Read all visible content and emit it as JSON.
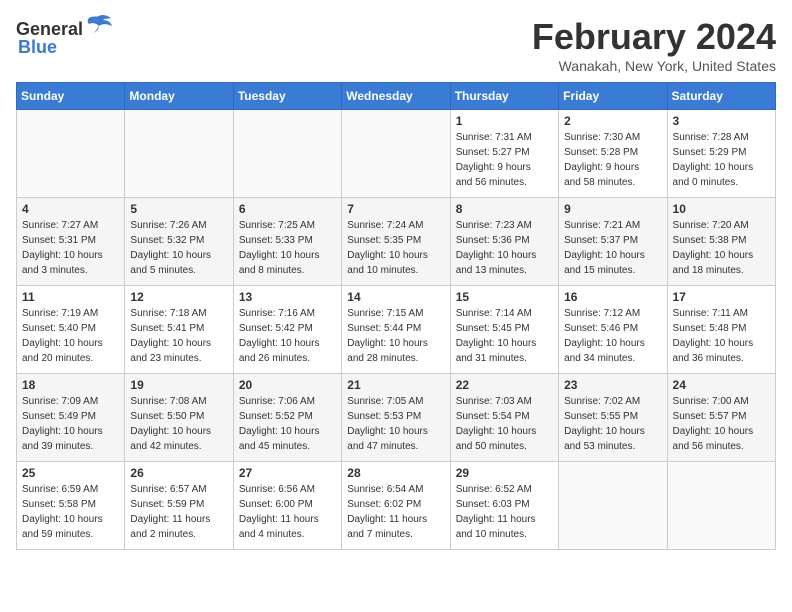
{
  "header": {
    "logo_general": "General",
    "logo_blue": "Blue",
    "month_year": "February 2024",
    "location": "Wanakah, New York, United States"
  },
  "days_of_week": [
    "Sunday",
    "Monday",
    "Tuesday",
    "Wednesday",
    "Thursday",
    "Friday",
    "Saturday"
  ],
  "weeks": [
    [
      {
        "day": "",
        "info": ""
      },
      {
        "day": "",
        "info": ""
      },
      {
        "day": "",
        "info": ""
      },
      {
        "day": "",
        "info": ""
      },
      {
        "day": "1",
        "info": "Sunrise: 7:31 AM\nSunset: 5:27 PM\nDaylight: 9 hours\nand 56 minutes."
      },
      {
        "day": "2",
        "info": "Sunrise: 7:30 AM\nSunset: 5:28 PM\nDaylight: 9 hours\nand 58 minutes."
      },
      {
        "day": "3",
        "info": "Sunrise: 7:28 AM\nSunset: 5:29 PM\nDaylight: 10 hours\nand 0 minutes."
      }
    ],
    [
      {
        "day": "4",
        "info": "Sunrise: 7:27 AM\nSunset: 5:31 PM\nDaylight: 10 hours\nand 3 minutes."
      },
      {
        "day": "5",
        "info": "Sunrise: 7:26 AM\nSunset: 5:32 PM\nDaylight: 10 hours\nand 5 minutes."
      },
      {
        "day": "6",
        "info": "Sunrise: 7:25 AM\nSunset: 5:33 PM\nDaylight: 10 hours\nand 8 minutes."
      },
      {
        "day": "7",
        "info": "Sunrise: 7:24 AM\nSunset: 5:35 PM\nDaylight: 10 hours\nand 10 minutes."
      },
      {
        "day": "8",
        "info": "Sunrise: 7:23 AM\nSunset: 5:36 PM\nDaylight: 10 hours\nand 13 minutes."
      },
      {
        "day": "9",
        "info": "Sunrise: 7:21 AM\nSunset: 5:37 PM\nDaylight: 10 hours\nand 15 minutes."
      },
      {
        "day": "10",
        "info": "Sunrise: 7:20 AM\nSunset: 5:38 PM\nDaylight: 10 hours\nand 18 minutes."
      }
    ],
    [
      {
        "day": "11",
        "info": "Sunrise: 7:19 AM\nSunset: 5:40 PM\nDaylight: 10 hours\nand 20 minutes."
      },
      {
        "day": "12",
        "info": "Sunrise: 7:18 AM\nSunset: 5:41 PM\nDaylight: 10 hours\nand 23 minutes."
      },
      {
        "day": "13",
        "info": "Sunrise: 7:16 AM\nSunset: 5:42 PM\nDaylight: 10 hours\nand 26 minutes."
      },
      {
        "day": "14",
        "info": "Sunrise: 7:15 AM\nSunset: 5:44 PM\nDaylight: 10 hours\nand 28 minutes."
      },
      {
        "day": "15",
        "info": "Sunrise: 7:14 AM\nSunset: 5:45 PM\nDaylight: 10 hours\nand 31 minutes."
      },
      {
        "day": "16",
        "info": "Sunrise: 7:12 AM\nSunset: 5:46 PM\nDaylight: 10 hours\nand 34 minutes."
      },
      {
        "day": "17",
        "info": "Sunrise: 7:11 AM\nSunset: 5:48 PM\nDaylight: 10 hours\nand 36 minutes."
      }
    ],
    [
      {
        "day": "18",
        "info": "Sunrise: 7:09 AM\nSunset: 5:49 PM\nDaylight: 10 hours\nand 39 minutes."
      },
      {
        "day": "19",
        "info": "Sunrise: 7:08 AM\nSunset: 5:50 PM\nDaylight: 10 hours\nand 42 minutes."
      },
      {
        "day": "20",
        "info": "Sunrise: 7:06 AM\nSunset: 5:52 PM\nDaylight: 10 hours\nand 45 minutes."
      },
      {
        "day": "21",
        "info": "Sunrise: 7:05 AM\nSunset: 5:53 PM\nDaylight: 10 hours\nand 47 minutes."
      },
      {
        "day": "22",
        "info": "Sunrise: 7:03 AM\nSunset: 5:54 PM\nDaylight: 10 hours\nand 50 minutes."
      },
      {
        "day": "23",
        "info": "Sunrise: 7:02 AM\nSunset: 5:55 PM\nDaylight: 10 hours\nand 53 minutes."
      },
      {
        "day": "24",
        "info": "Sunrise: 7:00 AM\nSunset: 5:57 PM\nDaylight: 10 hours\nand 56 minutes."
      }
    ],
    [
      {
        "day": "25",
        "info": "Sunrise: 6:59 AM\nSunset: 5:58 PM\nDaylight: 10 hours\nand 59 minutes."
      },
      {
        "day": "26",
        "info": "Sunrise: 6:57 AM\nSunset: 5:59 PM\nDaylight: 11 hours\nand 2 minutes."
      },
      {
        "day": "27",
        "info": "Sunrise: 6:56 AM\nSunset: 6:00 PM\nDaylight: 11 hours\nand 4 minutes."
      },
      {
        "day": "28",
        "info": "Sunrise: 6:54 AM\nSunset: 6:02 PM\nDaylight: 11 hours\nand 7 minutes."
      },
      {
        "day": "29",
        "info": "Sunrise: 6:52 AM\nSunset: 6:03 PM\nDaylight: 11 hours\nand 10 minutes."
      },
      {
        "day": "",
        "info": ""
      },
      {
        "day": "",
        "info": ""
      }
    ]
  ]
}
